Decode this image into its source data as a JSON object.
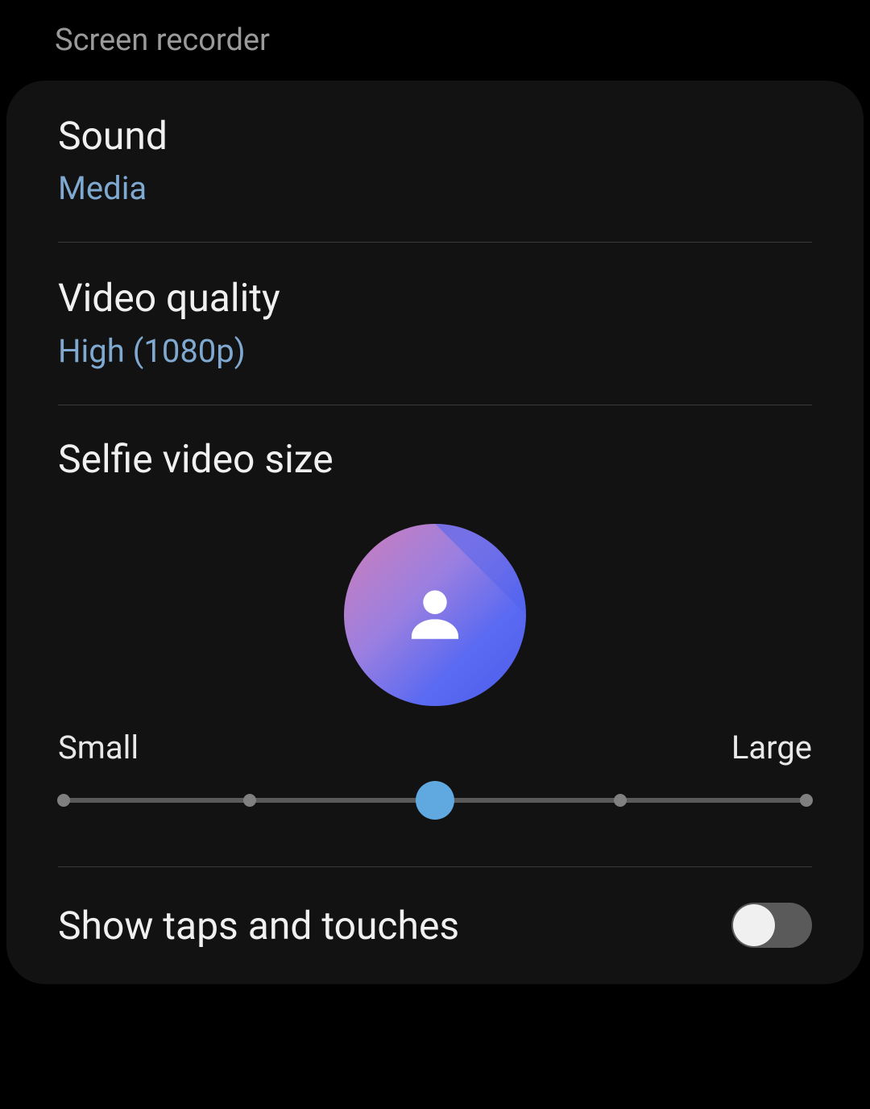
{
  "header": {
    "title": "Screen recorder"
  },
  "settings": {
    "sound": {
      "label": "Sound",
      "value": "Media"
    },
    "videoQuality": {
      "label": "Video quality",
      "value": "High (1080p)"
    },
    "selfieSize": {
      "label": "Selfie video size",
      "slider": {
        "min_label": "Small",
        "max_label": "Large",
        "steps": 5,
        "value_index": 2
      }
    },
    "showTaps": {
      "label": "Show taps and touches",
      "enabled": false
    }
  },
  "colors": {
    "accent": "#7fa9d0",
    "slider_thumb": "#5fa8e0"
  }
}
